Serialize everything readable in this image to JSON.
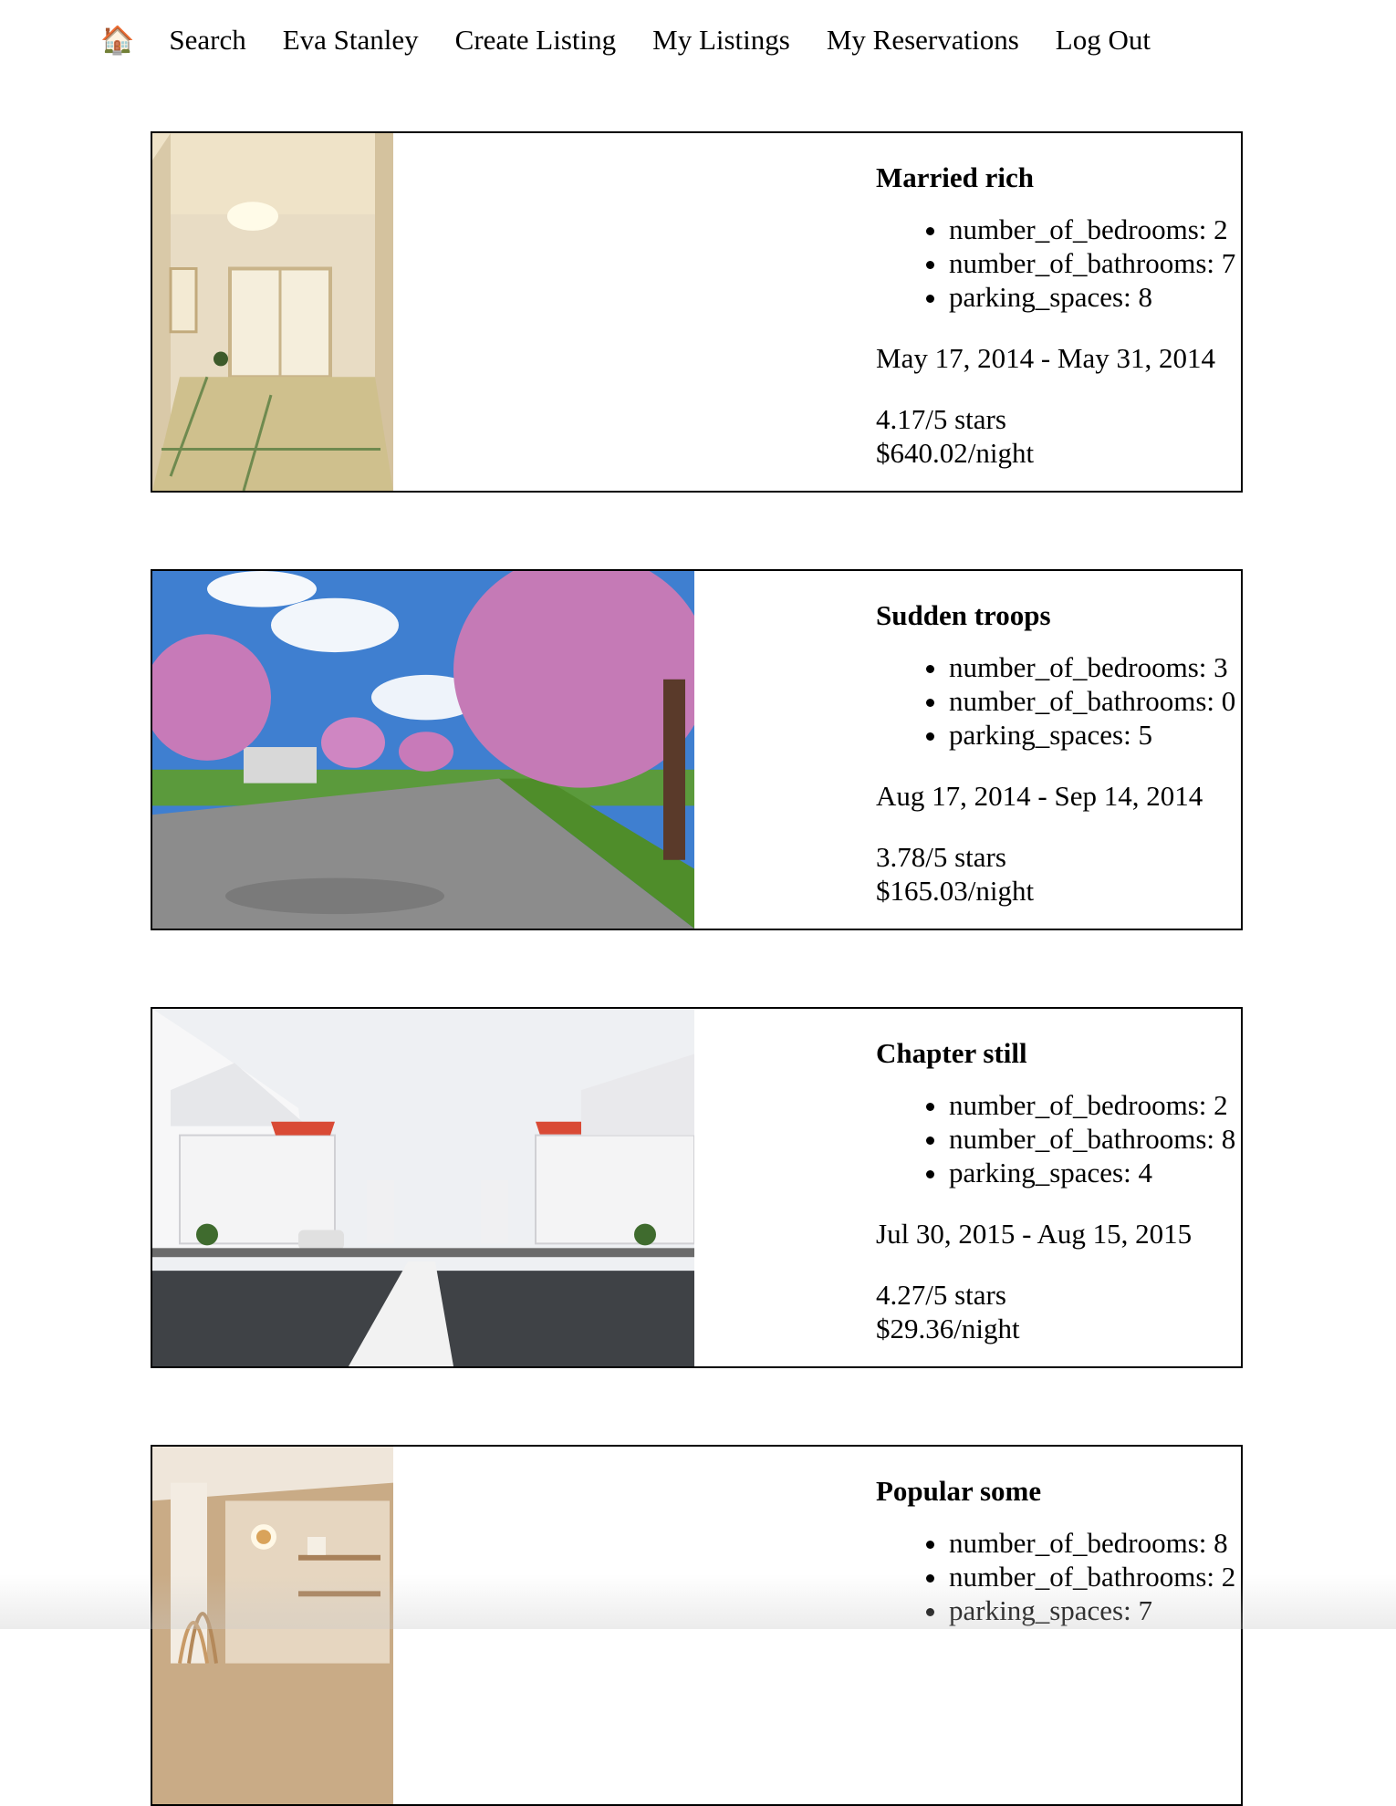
{
  "nav": {
    "home_icon": "🏠",
    "search": "Search",
    "user": "Eva Stanley",
    "create": "Create Listing",
    "my_listings": "My Listings",
    "my_reservations": "My Reservations",
    "logout": "Log Out"
  },
  "listings": [
    {
      "title": "Married rich",
      "bedrooms": "number_of_bedrooms: 2",
      "bathrooms": "number_of_bathrooms: 7",
      "parking": "parking_spaces: 8",
      "dates": "May 17, 2014 - May 31, 2014",
      "rating": "4.17/5 stars",
      "price": "$640.02/night"
    },
    {
      "title": "Sudden troops",
      "bedrooms": "number_of_bedrooms: 3",
      "bathrooms": "number_of_bathrooms: 0",
      "parking": "parking_spaces: 5",
      "dates": "Aug 17, 2014 - Sep 14, 2014",
      "rating": "3.78/5 stars",
      "price": "$165.03/night"
    },
    {
      "title": "Chapter still",
      "bedrooms": "number_of_bedrooms: 2",
      "bathrooms": "number_of_bathrooms: 8",
      "parking": "parking_spaces: 4",
      "dates": "Jul 30, 2015 - Aug 15, 2015",
      "rating": "4.27/5 stars",
      "price": "$29.36/night"
    },
    {
      "title": "Popular some",
      "bedrooms": "number_of_bedrooms: 8",
      "bathrooms": "number_of_bathrooms: 2",
      "parking": "parking_spaces: 7"
    }
  ]
}
